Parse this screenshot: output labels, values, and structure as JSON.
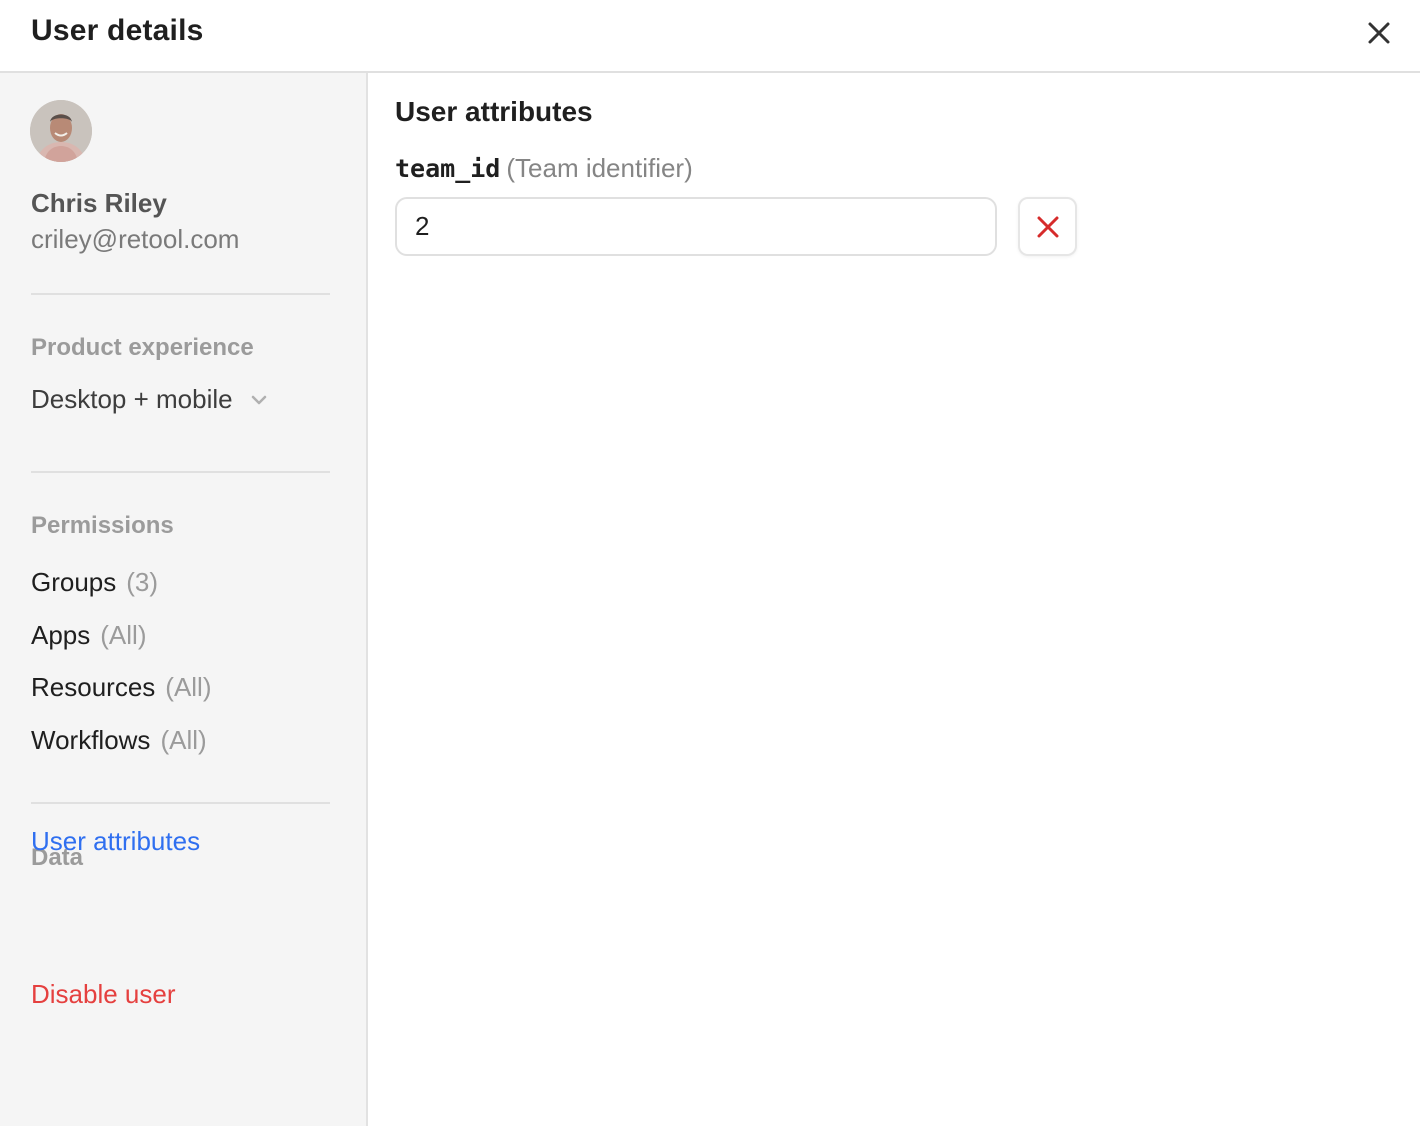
{
  "header": {
    "title": "User details",
    "close_icon": "close-icon"
  },
  "sidebar": {
    "user": {
      "name": "Chris Riley",
      "email": "criley@retool.com",
      "avatar": "avatar-photo"
    },
    "product_experience": {
      "label": "Product experience",
      "selected": "Desktop + mobile",
      "icon": "chevron-down-icon"
    },
    "permissions": {
      "label": "Permissions",
      "items": [
        {
          "label": "Groups",
          "count": "(3)"
        },
        {
          "label": "Apps",
          "count": "(All)"
        },
        {
          "label": "Resources",
          "count": "(All)"
        },
        {
          "label": "Workflows",
          "count": "(All)"
        }
      ]
    },
    "data": {
      "label": "Data",
      "link": "User attributes"
    },
    "disable_user": "Disable user"
  },
  "main": {
    "title": "User attributes",
    "attributes": [
      {
        "key": "team_id",
        "description": "(Team identifier)",
        "value": "2",
        "remove_icon": "x-icon"
      }
    ]
  },
  "colors": {
    "accent_blue": "#2f6ff0",
    "danger_red": "#e5403f",
    "remove_icon_red": "#d62b2b",
    "sidebar_bg": "#f5f5f5"
  }
}
